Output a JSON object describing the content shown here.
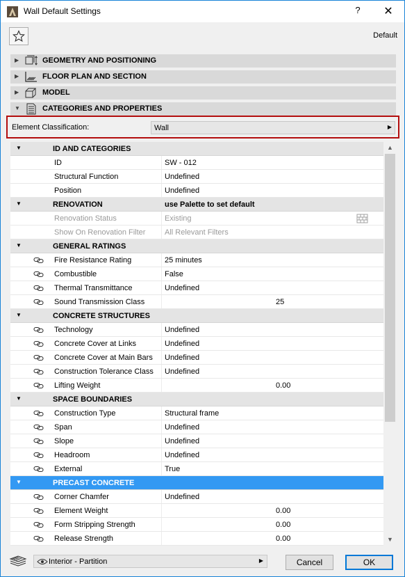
{
  "window": {
    "title": "Wall Default Settings",
    "help_label": "?",
    "close_label": "✕"
  },
  "header": {
    "default_label": "Default"
  },
  "sections": [
    {
      "label": "GEOMETRY AND POSITIONING",
      "icon": "geometry-icon",
      "expanded": false
    },
    {
      "label": "FLOOR PLAN AND SECTION",
      "icon": "floor-plan-icon",
      "expanded": false
    },
    {
      "label": "MODEL",
      "icon": "model-icon",
      "expanded": false
    },
    {
      "label": "CATEGORIES AND PROPERTIES",
      "icon": "categories-icon",
      "expanded": true
    }
  ],
  "classification": {
    "label": "Element Classification:",
    "value": "Wall"
  },
  "rows": [
    {
      "type": "group",
      "label": "ID AND CATEGORIES"
    },
    {
      "type": "prop",
      "name": "ID",
      "value": "SW - 012"
    },
    {
      "type": "prop",
      "name": "Structural Function",
      "value": "Undefined"
    },
    {
      "type": "prop",
      "name": "Position",
      "value": "Undefined"
    },
    {
      "type": "group",
      "label": "RENOVATION",
      "value": "use Palette to set default"
    },
    {
      "type": "prop",
      "name": "Renovation Status",
      "value": "Existing",
      "disabled": true,
      "brick": true
    },
    {
      "type": "prop",
      "name": "Show On Renovation Filter",
      "value": "All Relevant Filters",
      "disabled": true
    },
    {
      "type": "group",
      "label": "GENERAL RATINGS"
    },
    {
      "type": "prop",
      "name": "Fire Resistance Rating",
      "value": "25 minutes",
      "link": true
    },
    {
      "type": "prop",
      "name": "Combustible",
      "value": "False",
      "link": true
    },
    {
      "type": "prop",
      "name": "Thermal Transmittance",
      "value": "Undefined",
      "link": true
    },
    {
      "type": "prop",
      "name": "Sound Transmission Class",
      "num": "25",
      "link": true
    },
    {
      "type": "group",
      "label": "CONCRETE STRUCTURES"
    },
    {
      "type": "prop",
      "name": "Technology",
      "value": "Undefined",
      "link": true
    },
    {
      "type": "prop",
      "name": "Concrete Cover at Links",
      "value": "Undefined",
      "link": true
    },
    {
      "type": "prop",
      "name": "Concrete Cover at Main Bars",
      "value": "Undefined",
      "link": true
    },
    {
      "type": "prop",
      "name": "Construction Tolerance Class",
      "value": "Undefined",
      "link": true
    },
    {
      "type": "prop",
      "name": "Lifting Weight",
      "num": "0.00",
      "link": true
    },
    {
      "type": "group",
      "label": "SPACE BOUNDARIES"
    },
    {
      "type": "prop",
      "name": "Construction Type",
      "value": "Structural frame",
      "link": true
    },
    {
      "type": "prop",
      "name": "Span",
      "value": "Undefined",
      "link": true
    },
    {
      "type": "prop",
      "name": "Slope",
      "value": "Undefined",
      "link": true
    },
    {
      "type": "prop",
      "name": "Headroom",
      "value": "Undefined",
      "link": true
    },
    {
      "type": "prop",
      "name": "External",
      "value": "True",
      "link": true
    },
    {
      "type": "group",
      "label": "PRECAST CONCRETE",
      "selected": true
    },
    {
      "type": "prop",
      "name": "Corner Chamfer",
      "value": "Undefined",
      "link": true
    },
    {
      "type": "prop",
      "name": "Element Weight",
      "num": "0.00",
      "link": true
    },
    {
      "type": "prop",
      "name": "Form Stripping Strength",
      "num": "0.00",
      "link": true
    },
    {
      "type": "prop",
      "name": "Release Strength",
      "num": "0.00",
      "link": true
    }
  ],
  "footer": {
    "layer_value": "Interior - Partition",
    "cancel_label": "Cancel",
    "ok_label": "OK"
  },
  "colors": {
    "accent": "#0078d7",
    "selection": "#3399f3",
    "highlight_border": "#b30d0d"
  }
}
